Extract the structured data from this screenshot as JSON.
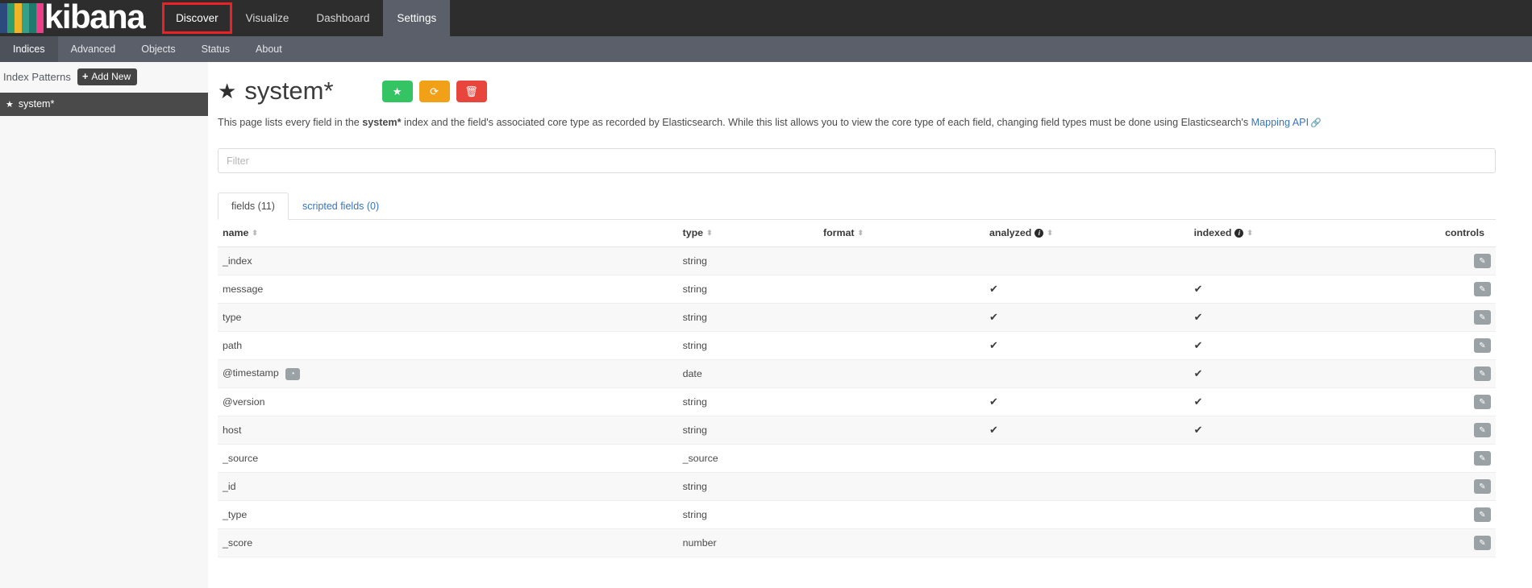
{
  "brand": {
    "word": "kibana",
    "bar_colors": [
      "#2c4a7c",
      "#2e9e6f",
      "#f0b429",
      "#34a08a",
      "#1f7a6e",
      "#ec3f87"
    ]
  },
  "navbar": {
    "links": [
      {
        "label": "Discover",
        "state": "highlight"
      },
      {
        "label": "Visualize",
        "state": "normal"
      },
      {
        "label": "Dashboard",
        "state": "normal"
      },
      {
        "label": "Settings",
        "state": "active"
      }
    ],
    "highlight_color": "#ec2127"
  },
  "subnav": {
    "items": [
      {
        "label": "Indices",
        "state": "active"
      },
      {
        "label": "Advanced",
        "state": "normal"
      },
      {
        "label": "Objects",
        "state": "normal"
      },
      {
        "label": "Status",
        "state": "normal"
      },
      {
        "label": "About",
        "state": "normal"
      }
    ]
  },
  "sidebar": {
    "title": "Index Patterns",
    "add_new_label": "Add New",
    "add_new_plus": "+",
    "items": [
      {
        "label": "system*",
        "star": "★",
        "selected": true
      }
    ]
  },
  "page": {
    "star": "★",
    "title": "system*",
    "description_pre": "This page lists every field in the ",
    "description_bold": "system*",
    "description_mid": " index and the field's associated core type as recorded by Elasticsearch. While this list allows you to view the core type of each field, changing field types must be done using Elasticsearch's ",
    "description_link": "Mapping API",
    "link_icon": "🔗"
  },
  "actions": {
    "set_default": {
      "icon": "★",
      "color": "#34c463",
      "name": "set-default-index"
    },
    "refresh": {
      "icon": "⟳",
      "color": "#f0a117",
      "name": "refresh-fields"
    },
    "delete": {
      "icon": "🗑",
      "color": "#e8453c",
      "name": "delete-index-pattern"
    }
  },
  "filter": {
    "placeholder": "Filter",
    "value": ""
  },
  "tabs": [
    {
      "label": "fields (11)",
      "active": true
    },
    {
      "label": "scripted fields (0)",
      "active": false
    }
  ],
  "table": {
    "columns": [
      {
        "label": "name",
        "sortable": true,
        "info": false,
        "align": "left"
      },
      {
        "label": "type",
        "sortable": true,
        "info": false,
        "align": "left"
      },
      {
        "label": "format",
        "sortable": true,
        "info": false,
        "align": "left"
      },
      {
        "label": "analyzed",
        "sortable": true,
        "info": true,
        "align": "left"
      },
      {
        "label": "indexed",
        "sortable": true,
        "info": true,
        "align": "left"
      },
      {
        "label": "controls",
        "sortable": false,
        "info": false,
        "align": "right"
      }
    ],
    "sort_glyph": "⬍",
    "info_glyph": "i",
    "check_glyph": "✔",
    "clock_glyph": "◔",
    "edit_glyph": "✎",
    "rows": [
      {
        "name": "_index",
        "time_badge": false,
        "type": "string",
        "format": "",
        "analyzed": false,
        "indexed": false
      },
      {
        "name": "message",
        "time_badge": false,
        "type": "string",
        "format": "",
        "analyzed": true,
        "indexed": true
      },
      {
        "name": "type",
        "time_badge": false,
        "type": "string",
        "format": "",
        "analyzed": true,
        "indexed": true
      },
      {
        "name": "path",
        "time_badge": false,
        "type": "string",
        "format": "",
        "analyzed": true,
        "indexed": true
      },
      {
        "name": "@timestamp",
        "time_badge": true,
        "type": "date",
        "format": "",
        "analyzed": false,
        "indexed": true
      },
      {
        "name": "@version",
        "time_badge": false,
        "type": "string",
        "format": "",
        "analyzed": true,
        "indexed": true
      },
      {
        "name": "host",
        "time_badge": false,
        "type": "string",
        "format": "",
        "analyzed": true,
        "indexed": true
      },
      {
        "name": "_source",
        "time_badge": false,
        "type": "_source",
        "format": "",
        "analyzed": false,
        "indexed": false
      },
      {
        "name": "_id",
        "time_badge": false,
        "type": "string",
        "format": "",
        "analyzed": false,
        "indexed": false
      },
      {
        "name": "_type",
        "time_badge": false,
        "type": "string",
        "format": "",
        "analyzed": false,
        "indexed": false
      },
      {
        "name": "_score",
        "time_badge": false,
        "type": "number",
        "format": "",
        "analyzed": false,
        "indexed": false
      }
    ]
  }
}
